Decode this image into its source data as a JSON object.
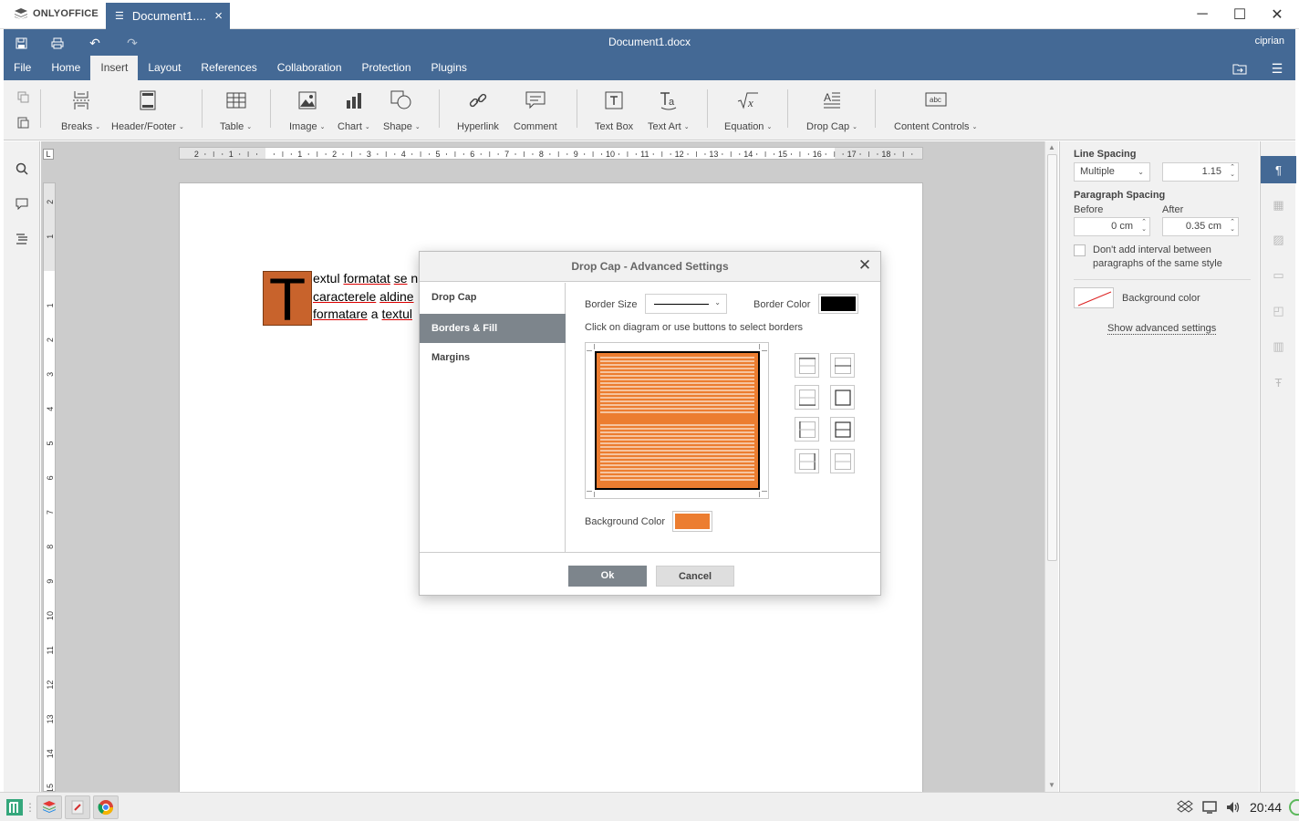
{
  "titlebar": {
    "app_name": "ONLYOFFICE",
    "tab_label": "Document1....",
    "minimize": "─",
    "maximize": "☐",
    "close": "✕"
  },
  "header": {
    "doc_title": "Document1.docx",
    "user": "ciprian",
    "menu_tabs": [
      "File",
      "Home",
      "Insert",
      "Layout",
      "References",
      "Collaboration",
      "Protection",
      "Plugins"
    ],
    "active_tab": "Insert"
  },
  "toolbar": {
    "buttons": [
      {
        "label": "Breaks",
        "icon": "page-break-icon"
      },
      {
        "label": "Header/Footer",
        "icon": "header-footer-icon"
      },
      {
        "label": "Table",
        "icon": "table-icon"
      },
      {
        "label": "Image",
        "icon": "image-icon"
      },
      {
        "label": "Chart",
        "icon": "chart-icon"
      },
      {
        "label": "Shape",
        "icon": "shape-icon"
      },
      {
        "label": "Hyperlink",
        "icon": "link-icon"
      },
      {
        "label": "Comment",
        "icon": "comment-icon"
      },
      {
        "label": "Text Box",
        "icon": "text-box-icon"
      },
      {
        "label": "Text Art",
        "icon": "text-art-icon"
      },
      {
        "label": "Equation",
        "icon": "equation-icon"
      },
      {
        "label": "Drop Cap",
        "icon": "drop-cap-icon"
      },
      {
        "label": "Content Controls",
        "icon": "content-controls-icon"
      }
    ]
  },
  "document": {
    "drop_cap_letter": "T",
    "lines": [
      [
        "extul ",
        "formatat",
        " ",
        "se",
        " n"
      ],
      [
        "caracterele",
        " ",
        "aldine"
      ],
      [
        "formatare",
        " a ",
        "textul"
      ]
    ]
  },
  "right_panel": {
    "line_spacing_title": "Line Spacing",
    "line_spacing_mode": "Multiple",
    "line_spacing_value": "1.15",
    "paragraph_spacing_title": "Paragraph Spacing",
    "before_label": "Before",
    "before_value": "0 cm",
    "after_label": "After",
    "after_value": "0.35 cm",
    "checkbox_label": "Don't add interval between paragraphs of the same style",
    "background_color_label": "Background color",
    "advanced_link": "Show advanced settings"
  },
  "dialog": {
    "title": "Drop Cap - Advanced Settings",
    "nav": [
      "Drop Cap",
      "Borders & Fill",
      "Margins"
    ],
    "active_nav": "Borders & Fill",
    "border_size_label": "Border Size",
    "border_color_label": "Border Color",
    "border_color": "#000000",
    "hint": "Click on diagram or use buttons to select borders",
    "background_color_label": "Background Color",
    "background_color": "#ec7d30",
    "ok_label": "Ok",
    "cancel_label": "Cancel"
  },
  "taskbar": {
    "clock": "20:44"
  },
  "colors": {
    "accent": "#446995",
    "drop_cap_fill": "#c8632c"
  }
}
